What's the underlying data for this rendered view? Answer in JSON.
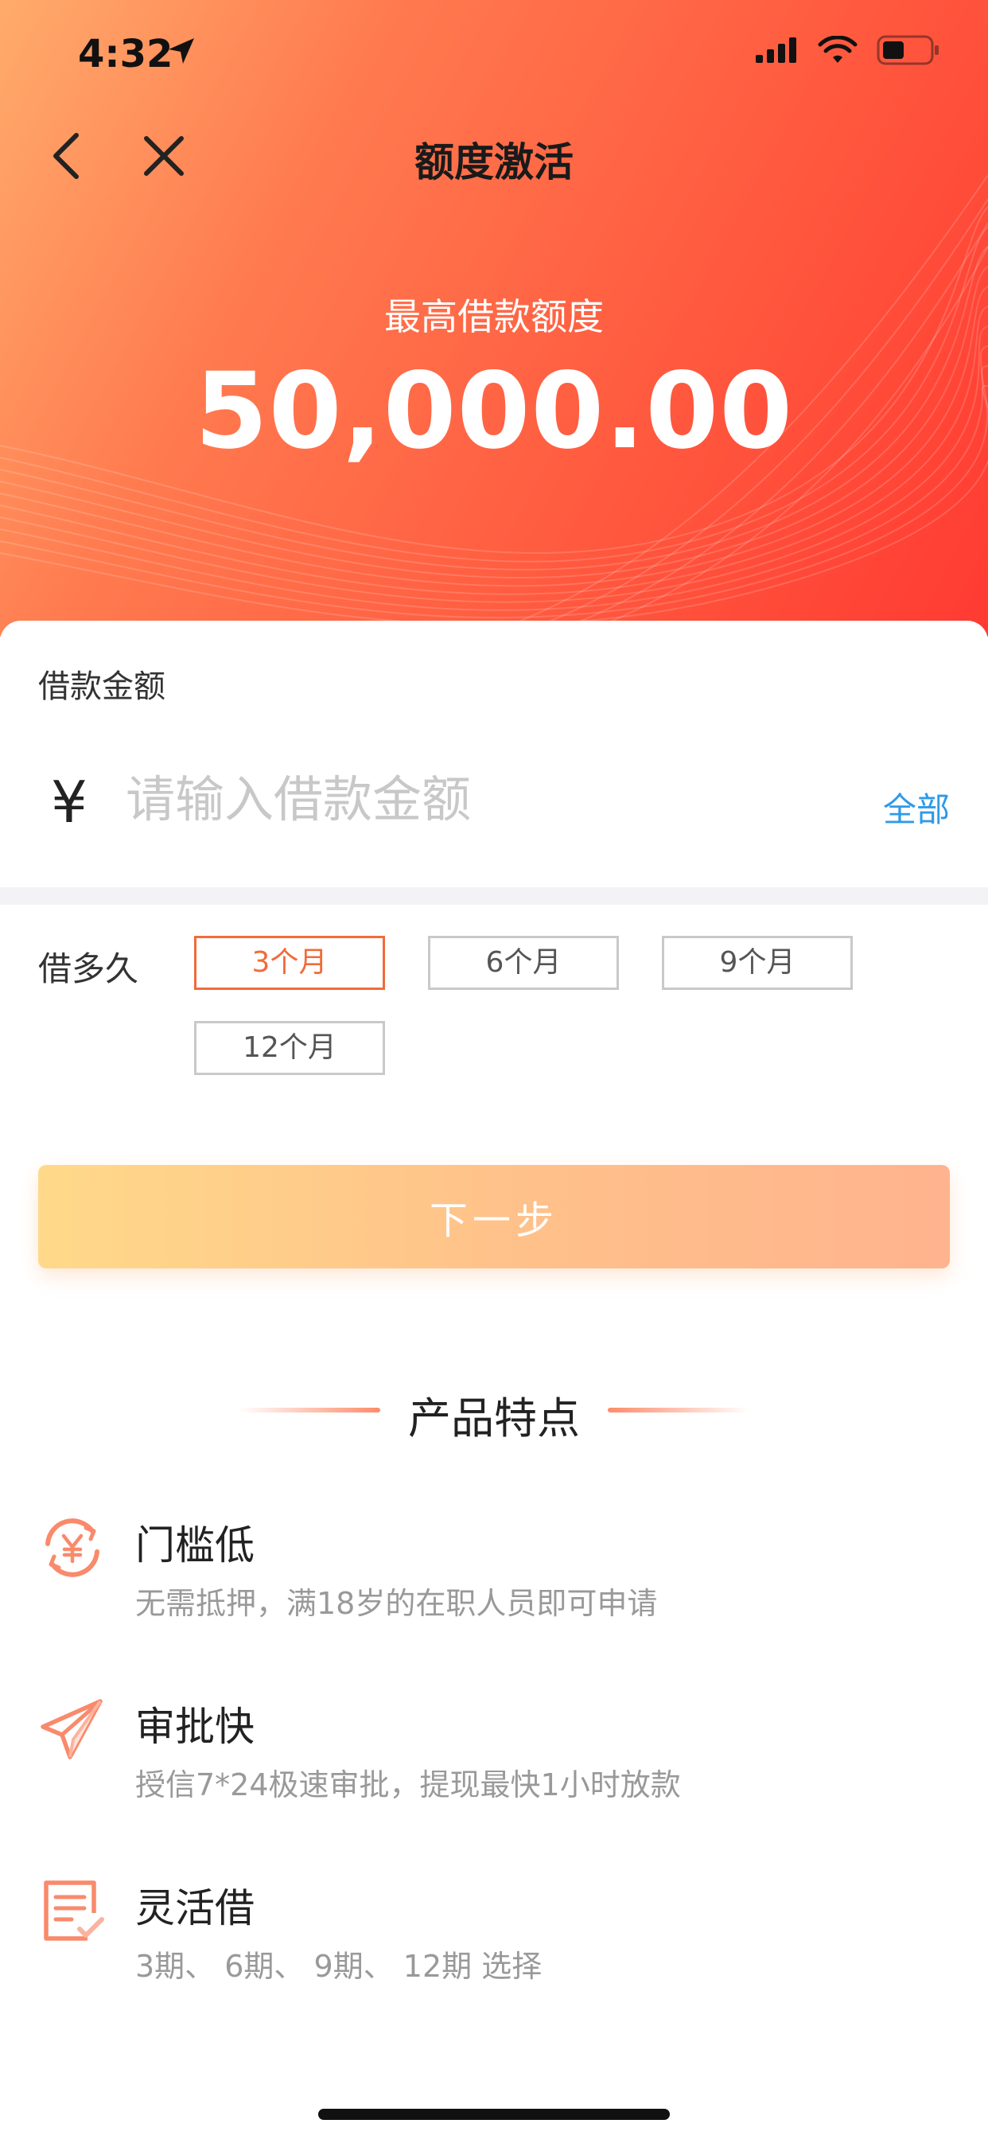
{
  "status_bar": {
    "time": "4:32"
  },
  "nav": {
    "title": "额度激活"
  },
  "hero": {
    "limit_label": "最高借款额度",
    "limit_amount": "50,000.00"
  },
  "loan_amount": {
    "label": "借款金额",
    "currency_symbol": "¥",
    "placeholder": "请输入借款金额",
    "all_label": "全部"
  },
  "term": {
    "label": "借多久",
    "selected": "3个月",
    "options": [
      "3个月",
      "6个月",
      "9个月",
      "12个月"
    ]
  },
  "next_button": {
    "label": "下一步"
  },
  "features": {
    "title": "产品特点",
    "items": [
      {
        "icon": "yen-cycle-icon",
        "title": "门槛低",
        "desc": "无需抵押，满18岁的在职人员即可申请"
      },
      {
        "icon": "paper-plane-icon",
        "title": "审批快",
        "desc": "授信7*24极速审批，提现最快1小时放款"
      },
      {
        "icon": "checklist-icon",
        "title": "灵活借",
        "desc": "3期、 6期、 9期、 12期  选择"
      }
    ]
  },
  "colors": {
    "accent": "#f26b3a",
    "link": "#2f9ae8",
    "hero_start": "#ffab6c",
    "hero_end": "#ff3a32"
  }
}
